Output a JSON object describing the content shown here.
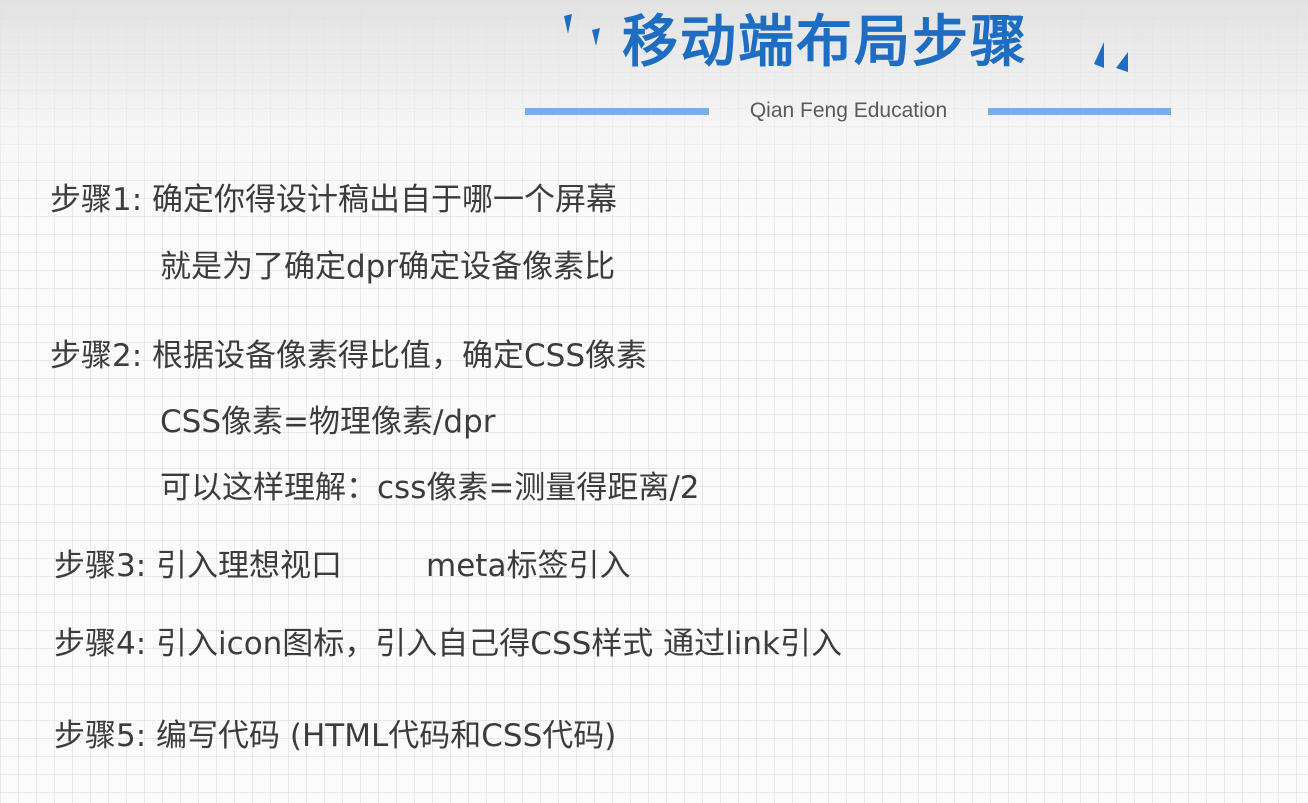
{
  "header": {
    "title": "移动端布局步骤",
    "subtitle": "Qian Feng Education",
    "accent_color": "#1f6dc2",
    "line_color": "#7aaee6"
  },
  "steps": [
    {
      "label": "步骤1:",
      "text": "确定你得设计稿出自于哪一个屏幕",
      "notes": [
        "就是为了确定dpr确定设备像素比"
      ]
    },
    {
      "label": "步骤2:",
      "text": "根据设备像素得比值，确定CSS像素",
      "notes": [
        "CSS像素=物理像素/dpr",
        "可以这样理解：css像素=测量得距离/2"
      ]
    },
    {
      "label": "步骤3:",
      "text": "引入理想视口",
      "extra": "meta标签引入"
    },
    {
      "label": "步骤4:",
      "text": "引入icon图标，引入自己得CSS样式 通过link引入"
    },
    {
      "label": "步骤5:",
      "text": "编写代码 (HTML代码和CSS代码)"
    }
  ]
}
